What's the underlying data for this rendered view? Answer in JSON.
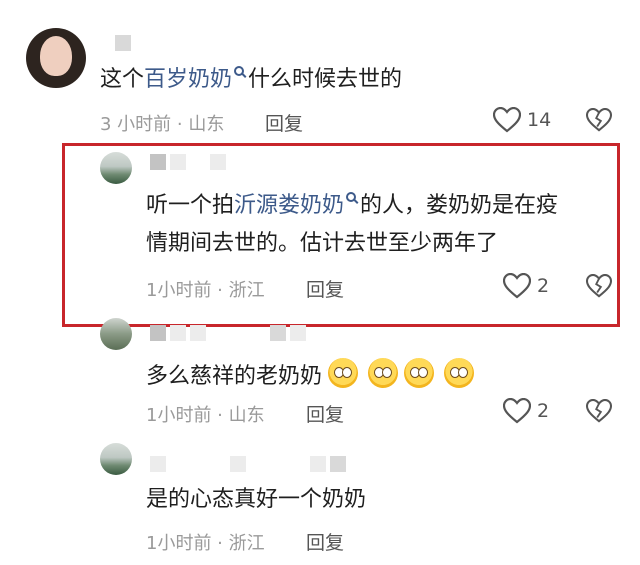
{
  "comments": [
    {
      "text_before": "这个",
      "link": "百岁奶奶",
      "text_after": "什么时候去世的",
      "meta": "3 小时前 · 山东",
      "reply": "回复",
      "likes": "14"
    },
    {
      "text_line1_before": "听一个拍",
      "link": "沂源娄奶奶",
      "text_line1_after": "的人，娄奶奶是在疫",
      "text_line2": "情期间去世的。估计去世至少两年了",
      "meta": "1小时前 · 浙江",
      "reply": "回复",
      "likes": "2"
    },
    {
      "text": "多么慈祥的老奶奶",
      "meta": "1小时前 · 山东",
      "reply": "回复",
      "likes": "2"
    },
    {
      "text": "是的心态真好一个奶奶",
      "meta": "1小时前 · 浙江",
      "reply": "回复"
    }
  ]
}
